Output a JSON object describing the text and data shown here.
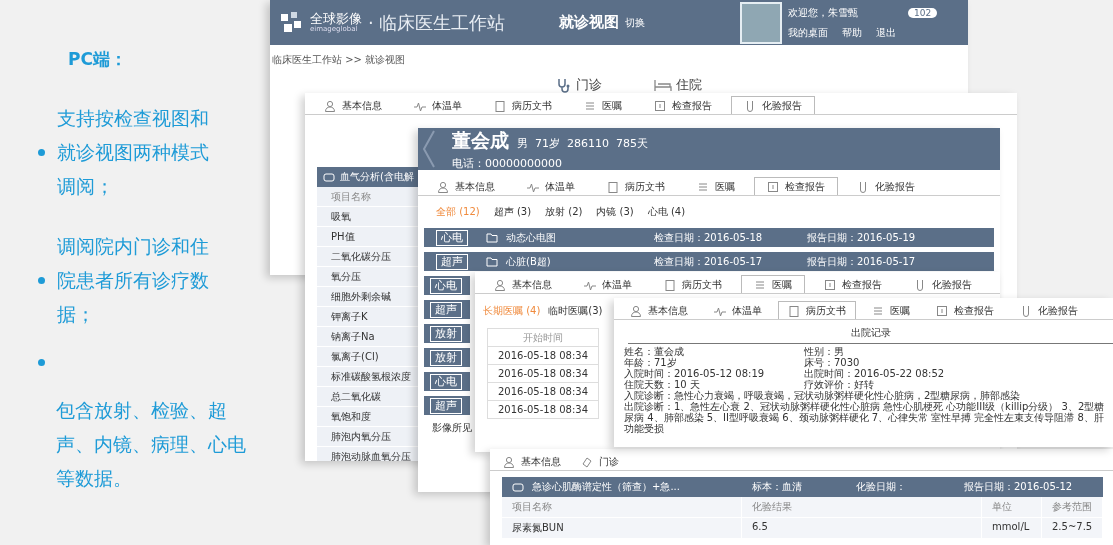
{
  "intro": {
    "title": "PC端：",
    "items": [
      {
        "kind": "bullet",
        "text": "支持按检查视图和就诊视图两种模式调阅；"
      },
      {
        "kind": "bullet",
        "text": "调阅院内门诊和住院患者所有诊疗数据；"
      },
      {
        "kind": "dot"
      },
      {
        "kind": "plain",
        "text": "包含放射、检验、超声、内镜、病理、心电等数据。"
      }
    ]
  },
  "workstation": {
    "logo_name": "全球影像",
    "logo_sub": "eimageglobal",
    "title": "· 临床医生工作站",
    "view": "就诊视图",
    "view_switch": "切换",
    "welcome": "欢迎您，朱雪甄",
    "badge": "102",
    "links": [
      "我的桌面",
      "帮助",
      "退出"
    ],
    "breadcrumb": "临床医生工作站 >> 就诊视图",
    "modes": [
      "门诊",
      "住院"
    ]
  },
  "lab_window": {
    "tabs": [
      {
        "label": "基本信息",
        "selected": false
      },
      {
        "label": "体温单",
        "selected": false
      },
      {
        "label": "病历文书",
        "selected": false
      },
      {
        "label": "医嘱",
        "selected": false
      },
      {
        "label": "检查报告",
        "selected": false
      },
      {
        "label": "化验报告",
        "selected": true
      }
    ],
    "panel_title": "血气分析(含电解",
    "column": "项目名称",
    "items": [
      "吸氧",
      "PH值",
      "二氧化碳分压",
      "氧分压",
      "细胞外剩余碱",
      "钾离子K",
      "钠离子Na",
      "氯离子(Cl)",
      "标准碳酸氢根浓度",
      "总二氧化碳",
      "氧饱和度",
      "肺泡内氧分压",
      "肺泡动脉血氧分压"
    ]
  },
  "exam_window": {
    "patient_name": "董会成",
    "patient_info": "男  71岁  286110  785天",
    "phone": "电话：00000000000",
    "tabs": [
      {
        "label": "基本信息",
        "selected": false
      },
      {
        "label": "体温单",
        "selected": false
      },
      {
        "label": "病历文书",
        "selected": false
      },
      {
        "label": "医嘱",
        "selected": false
      },
      {
        "label": "检查报告",
        "selected": true
      },
      {
        "label": "化验报告",
        "selected": false
      }
    ],
    "filters": [
      {
        "label": "全部 (12)",
        "selected": true
      },
      {
        "label": "超声 (3)",
        "selected": false
      },
      {
        "label": "放射 (2)",
        "selected": false
      },
      {
        "label": "内镜 (3)",
        "selected": false
      },
      {
        "label": "心电 (4)",
        "selected": false
      }
    ],
    "reports": [
      {
        "tag": "心电",
        "name": "动态心电图",
        "exam_date": "检查日期：2016-05-18",
        "report_date": "报告日期：2016-05-19"
      },
      {
        "tag": "超声",
        "name": "心脏(B超)",
        "exam_date": "检查日期：2016-05-17",
        "report_date": "报告日期：2016-05-17"
      },
      {
        "tag": "心电"
      },
      {
        "tag": "超声"
      },
      {
        "tag": "放射"
      },
      {
        "tag": "放射"
      },
      {
        "tag": "心电"
      },
      {
        "tag": "超声"
      }
    ],
    "findings_label": "影像所见"
  },
  "orders_window": {
    "tabs": [
      {
        "label": "基本信息",
        "selected": false
      },
      {
        "label": "体温单",
        "selected": false
      },
      {
        "label": "病历文书",
        "selected": false
      },
      {
        "label": "医嘱",
        "selected": true
      },
      {
        "label": "检查报告",
        "selected": false
      },
      {
        "label": "化验报告",
        "selected": false
      }
    ],
    "order_types": [
      {
        "label": "长期医嘱 (4)",
        "selected": true
      },
      {
        "label": "临时医嘱(3)",
        "selected": false
      }
    ],
    "column": "开始时间",
    "rows": [
      "2016-05-18 08:34",
      "2016-05-18 08:34",
      "2016-05-18 08:34",
      "2016-05-18 08:34"
    ]
  },
  "record_window": {
    "tabs": [
      {
        "label": "基本信息",
        "selected": false
      },
      {
        "label": "体温单",
        "selected": false
      },
      {
        "label": "病历文书",
        "selected": true
      },
      {
        "label": "医嘱",
        "selected": false
      },
      {
        "label": "检查报告",
        "selected": false
      },
      {
        "label": "化验报告",
        "selected": false
      }
    ],
    "title": "出院记录",
    "fields": [
      [
        "姓名：董会成",
        "性别：男"
      ],
      [
        "年龄：71岁",
        "床号：7030"
      ],
      [
        "入院时间：2016-05-12 08:19",
        "出院时间：2016-05-22 08:52"
      ],
      [
        "住院天数：10 天",
        "疗效评价：好转"
      ]
    ],
    "admission_diagnosis": "入院诊断：急性心力衰竭，呼吸衰竭，冠状动脉粥样硬化性心脏病，2型糖尿病，肺部感染",
    "discharge_diagnosis": "出院诊断：1、急性左心衰 2、冠状动脉粥样硬化性心脏病 急性心肌梗死 心功能III级（killip分级） 3、2型糖尿病 4、肺部感染 5、II型呼吸衰竭 6、颈动脉粥样硬化 7、心律失常 室性早搏 完全性左束支传导阻滞 8、肝功能受损"
  },
  "lab_detail_window": {
    "tabs": [
      {
        "label": "基本信息",
        "selected": false
      },
      {
        "label": "门诊",
        "selected": false
      }
    ],
    "panel_title": "急诊心肌酶谱定性（筛查）+急...",
    "specimen": "标本：血清",
    "lab_date": "化验日期：",
    "report_date": "报告日期：2016-05-12",
    "columns": [
      "项目名称",
      "化验结果",
      "单位",
      "参考范围"
    ],
    "rows": [
      [
        "尿素氮BUN",
        "6.5",
        "mmol/L",
        "2.5~7.5"
      ]
    ]
  }
}
